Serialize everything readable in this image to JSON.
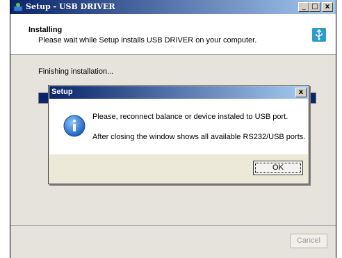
{
  "window": {
    "title": "Setup - USB DRIVER",
    "minimize_glyph": "_",
    "maximize_glyph": "□",
    "close_glyph": "x"
  },
  "header": {
    "title": "Installing",
    "subtitle": "Please wait while Setup installs USB DRIVER on your computer."
  },
  "main": {
    "status_text": "Finishing installation...",
    "progress": 1.0
  },
  "footer": {
    "cancel_label": "Cancel",
    "cancel_enabled": false
  },
  "dialog": {
    "title": "Setup",
    "close_glyph": "x",
    "message_line1": "Please, reconnect balance or device instaled to USB port.",
    "message_line2": "After closing the window shows all available RS232/USB ports.",
    "ok_label": "OK",
    "icon": "info-icon"
  },
  "colors": {
    "titlebar_start": "#0a246a",
    "titlebar_end": "#a6caf0",
    "progress_fill": "#0a246a"
  }
}
